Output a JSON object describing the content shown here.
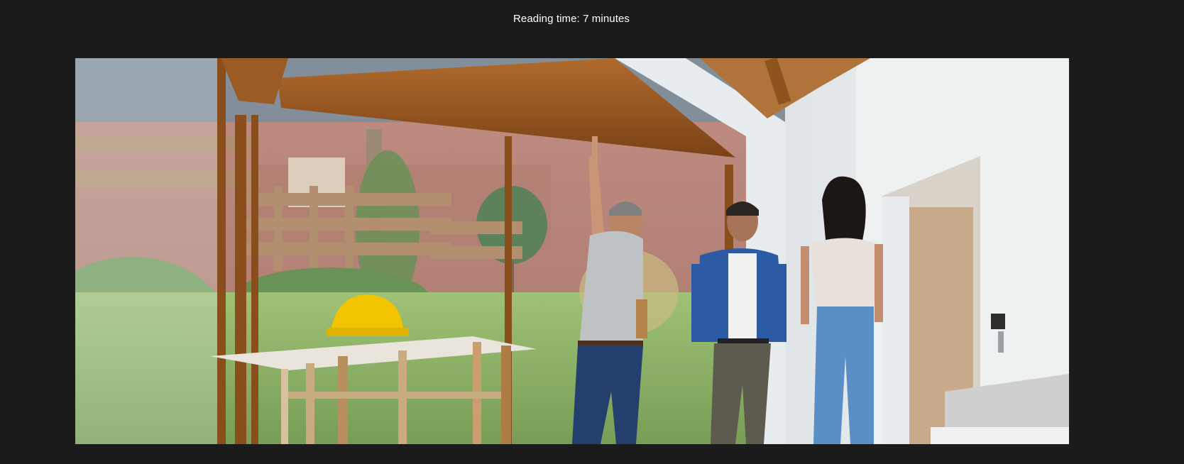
{
  "article": {
    "reading_time": "Reading time: 7 minutes"
  },
  "hero_image": {
    "alt": "Contractor in grey shirt pointing up at a wooden window beam while a man in a denim shirt and a woman in a white t-shirt look up inside a bright room; a yellow hard hat rests on a sawhorse table",
    "colors": {
      "background": "#1b1b1b",
      "wood": "#9c5a22",
      "wall": "#e9edef",
      "grass": "#7fa84a",
      "hard_hat": "#f2c400",
      "denim": "#2f5a9a"
    }
  }
}
